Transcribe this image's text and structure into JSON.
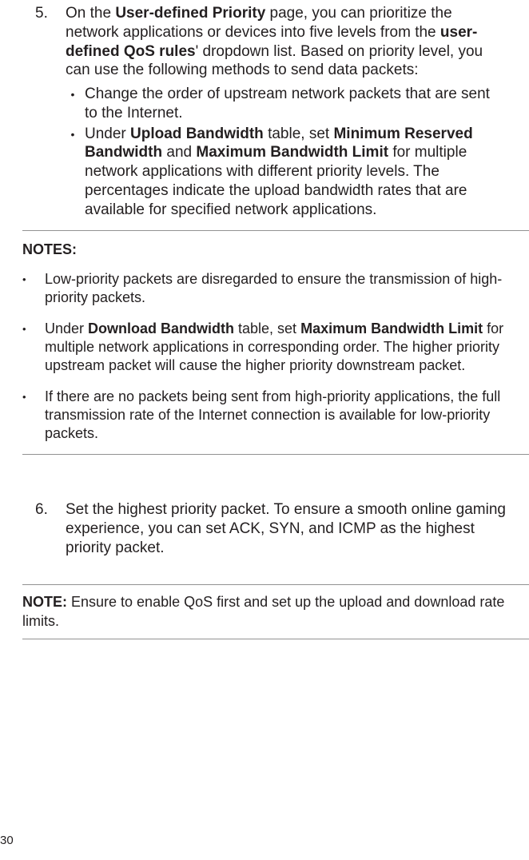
{
  "step5": {
    "number": "5.",
    "pre1": "On the ",
    "bold1": "User-defined Priority",
    "mid1": " page, you can prioritize the network applications or devices into five levels from the ",
    "bold2": "user-defined QoS rules",
    "post1": "' dropdown list. Based on priority level, you can use the following methods to send data packets:",
    "sub1": "Change the order of upstream network packets that are sent to the Internet.",
    "sub2_pre": "Under ",
    "sub2_b1": "Upload Bandwidth",
    "sub2_mid1": " table, set ",
    "sub2_b2": "Minimum Reserved Bandwidth",
    "sub2_mid2": " and ",
    "sub2_b3": "Maximum Bandwidth Limit",
    "sub2_post": " for multiple network applications with different priority levels. The percentages indicate the upload bandwidth rates that are available for specified network applications."
  },
  "notes": {
    "heading": "NOTES:",
    "n1": "Low-priority packets are disregarded to ensure the transmission of high-priority packets.",
    "n2_pre": "Under ",
    "n2_b1": "Download Bandwidth",
    "n2_mid": " table, set ",
    "n2_b2": "Maximum Bandwidth Limit",
    "n2_post": " for multiple network applications in corresponding order. The higher priority upstream packet will cause the higher priority downstream packet.",
    "n3": "If there are no packets being sent from high-priority applications, the full transmission rate of the Internet connection is available for low-priority packets."
  },
  "step6": {
    "number": "6.",
    "text": "Set the highest priority packet. To ensure a smooth online gaming experience, you can set ACK, SYN, and ICMP as the highest priority packet."
  },
  "note_single": {
    "label": "NOTE:",
    "text": "  Ensure to enable QoS first and set up the upload and download rate limits."
  },
  "page_number": "30"
}
